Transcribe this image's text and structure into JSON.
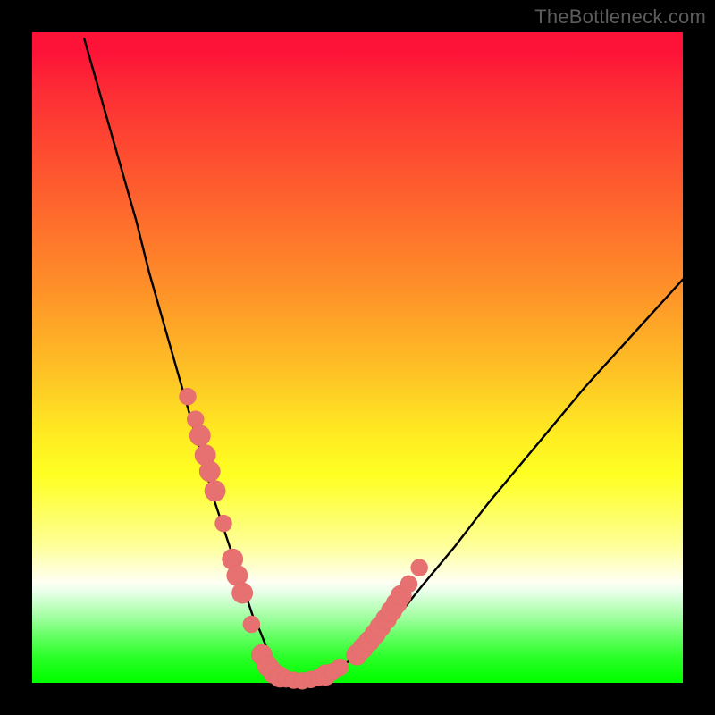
{
  "watermark": "TheBottleneck.com",
  "colors": {
    "curve": "#000000",
    "marker_fill": "#e77070",
    "marker_stroke": "#e06a6a"
  },
  "chart_data": {
    "type": "line",
    "title": "",
    "xlabel": "",
    "ylabel": "",
    "xlim": [
      0,
      100
    ],
    "ylim": [
      0,
      100
    ],
    "grid": false,
    "legend": false,
    "series": [
      {
        "name": "curve",
        "x": [
          8,
          10,
          12,
          14,
          16,
          18,
          20,
          22,
          24,
          26,
          28,
          30,
          32,
          33,
          34,
          35,
          36,
          37,
          38,
          39,
          40,
          42,
          45,
          48,
          52,
          56,
          60,
          65,
          70,
          75,
          80,
          85,
          90,
          95,
          100
        ],
        "y": [
          99,
          92,
          85,
          78,
          71,
          63,
          56,
          49,
          42,
          35,
          28,
          22,
          16,
          13,
          10,
          8,
          5.5,
          3.5,
          2,
          1,
          0.5,
          0.3,
          1,
          2.8,
          6,
          10,
          15,
          21,
          27.5,
          33.5,
          39.5,
          45.5,
          51,
          56.5,
          62
        ]
      }
    ],
    "markers": [
      {
        "name": "m1",
        "x": 23.9,
        "y": 44.0,
        "r": 1.3
      },
      {
        "name": "m2",
        "x": 25.1,
        "y": 40.5,
        "r": 1.3
      },
      {
        "name": "m3",
        "x": 25.8,
        "y": 38.0,
        "r": 1.6
      },
      {
        "name": "m4",
        "x": 26.6,
        "y": 35.0,
        "r": 1.6
      },
      {
        "name": "m5",
        "x": 27.3,
        "y": 32.5,
        "r": 1.6
      },
      {
        "name": "m6",
        "x": 28.1,
        "y": 29.5,
        "r": 1.6
      },
      {
        "name": "m7",
        "x": 29.4,
        "y": 24.5,
        "r": 1.3
      },
      {
        "name": "m8",
        "x": 30.8,
        "y": 19.0,
        "r": 1.6
      },
      {
        "name": "m9",
        "x": 31.5,
        "y": 16.5,
        "r": 1.6
      },
      {
        "name": "m10",
        "x": 32.3,
        "y": 13.8,
        "r": 1.6
      },
      {
        "name": "m11",
        "x": 33.7,
        "y": 9.0,
        "r": 1.3
      },
      {
        "name": "m12",
        "x": 35.3,
        "y": 4.3,
        "r": 1.6
      },
      {
        "name": "m13",
        "x": 36.2,
        "y": 2.6,
        "r": 1.6
      },
      {
        "name": "m14",
        "x": 37.1,
        "y": 1.5,
        "r": 1.6
      },
      {
        "name": "m15",
        "x": 38.1,
        "y": 0.9,
        "r": 1.6
      },
      {
        "name": "m16",
        "x": 39.0,
        "y": 0.6,
        "r": 1.3
      },
      {
        "name": "m17",
        "x": 40.2,
        "y": 0.4,
        "r": 1.3
      },
      {
        "name": "m18",
        "x": 41.5,
        "y": 0.3,
        "r": 1.3
      },
      {
        "name": "m19",
        "x": 42.8,
        "y": 0.5,
        "r": 1.3
      },
      {
        "name": "m20",
        "x": 44.0,
        "y": 0.8,
        "r": 1.3
      },
      {
        "name": "m21",
        "x": 45.1,
        "y": 1.2,
        "r": 1.6
      },
      {
        "name": "m22",
        "x": 46.2,
        "y": 1.7,
        "r": 1.3
      },
      {
        "name": "m23",
        "x": 47.3,
        "y": 2.4,
        "r": 1.3
      },
      {
        "name": "m24",
        "x": 49.9,
        "y": 4.3,
        "r": 1.6
      },
      {
        "name": "m25",
        "x": 50.8,
        "y": 5.3,
        "r": 1.6
      },
      {
        "name": "m26",
        "x": 51.8,
        "y": 6.4,
        "r": 1.6
      },
      {
        "name": "m27",
        "x": 52.7,
        "y": 7.5,
        "r": 1.6
      },
      {
        "name": "m28",
        "x": 53.5,
        "y": 8.6,
        "r": 1.6
      },
      {
        "name": "m29",
        "x": 54.4,
        "y": 9.8,
        "r": 1.6
      },
      {
        "name": "m30",
        "x": 55.2,
        "y": 11.0,
        "r": 1.6
      },
      {
        "name": "m31",
        "x": 56.0,
        "y": 12.2,
        "r": 1.6
      },
      {
        "name": "m32",
        "x": 56.7,
        "y": 13.4,
        "r": 1.6
      },
      {
        "name": "m33",
        "x": 57.9,
        "y": 15.2,
        "r": 1.3
      },
      {
        "name": "m34",
        "x": 59.5,
        "y": 17.7,
        "r": 1.3
      }
    ]
  }
}
